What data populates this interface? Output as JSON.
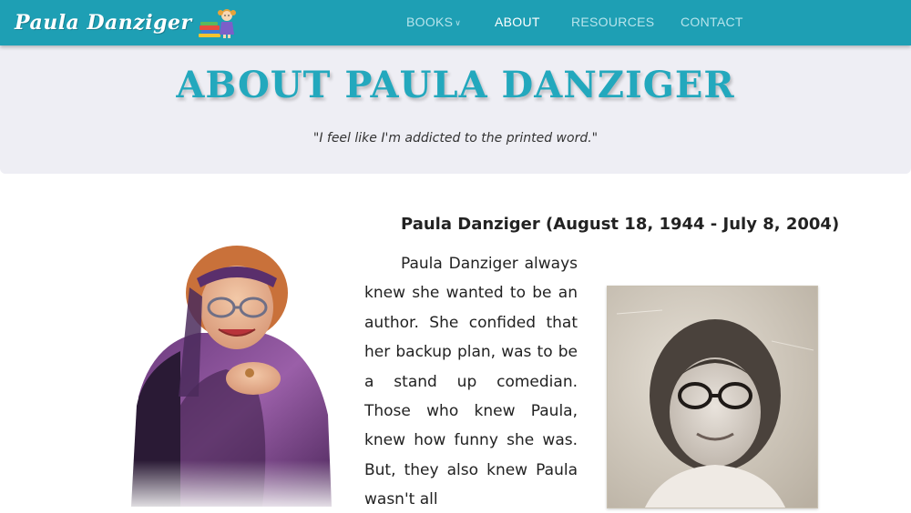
{
  "header": {
    "logo_text": "Paula Danziger",
    "logo_icon": "reading-girl-with-books-icon",
    "brand_color": "#1e9fb4",
    "nav": [
      {
        "label": "BOOKS",
        "has_dropdown": true,
        "active": false
      },
      {
        "label": "ABOUT",
        "has_dropdown": false,
        "active": true
      },
      {
        "label": "RESOURCES",
        "has_dropdown": false,
        "active": false
      },
      {
        "label": "CONTACT",
        "has_dropdown": false,
        "active": false
      }
    ]
  },
  "hero": {
    "title": "ABOUT PAULA DANZIGER",
    "quote": "\"I feel like I'm addicted to the printed word.\"",
    "title_color": "#23a8bd",
    "background": "#eeeef4"
  },
  "main": {
    "heading": "Paula Danziger (August 18, 1944 - July 8, 2004)",
    "paragraph": "Paula Danziger always knew she wanted to be an author. She confided that her backup plan, was to be a stand up comedian. Those who knew Paula, knew how funny she was. But, they also knew Paula wasn't all",
    "images": {
      "adult_photo": "portrait-of-paula-danziger",
      "child_photo": "childhood-photo-of-paula"
    }
  }
}
